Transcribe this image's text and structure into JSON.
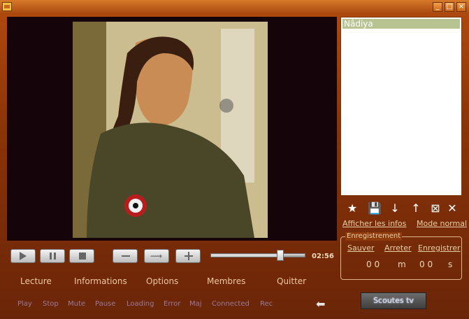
{
  "titlebar": {
    "icons": [
      "app-icon",
      "minimize-icon",
      "maximize-icon",
      "close-icon"
    ]
  },
  "playlist": {
    "items": [
      {
        "label": "Nâdiya"
      }
    ]
  },
  "playlist_controls": [
    {
      "name": "favorite-icon",
      "symbol": "★"
    },
    {
      "name": "save-icon",
      "symbol": "💾"
    },
    {
      "name": "move-down-icon",
      "symbol": "↓"
    },
    {
      "name": "move-up-icon",
      "symbol": "↑"
    },
    {
      "name": "remove-icon",
      "symbol": "⊠"
    },
    {
      "name": "tools-icon",
      "symbol": "✕"
    }
  ],
  "links": {
    "info": "Afficher les infos",
    "mode": "Mode normal"
  },
  "recording": {
    "title": "Enregistrement",
    "save": "Sauver",
    "stop": "Arreter",
    "record": "Enregistrer",
    "minutes": "0 0",
    "minutes_unit": "m",
    "seconds": "0 0",
    "seconds_unit": "s"
  },
  "player": {
    "time": "02:56",
    "seek_fraction": 0.74,
    "buttons": [
      "play-icon",
      "pause-icon",
      "stop-icon",
      "volume-down-icon",
      "mute-icon",
      "volume-up-icon"
    ]
  },
  "menu": [
    "Lecture",
    "Informations",
    "Options",
    "Membres",
    "Quitter"
  ],
  "status": [
    "Play",
    "Stop",
    "Mute",
    "Pause",
    "Loading",
    "Error",
    "Maj",
    "Connected",
    "Rec"
  ],
  "logo": {
    "text": "Scoutes tv"
  },
  "colors": {
    "frame": "#8a3408",
    "accent": "#b24a10",
    "playlist_selected": "#b7c492"
  }
}
